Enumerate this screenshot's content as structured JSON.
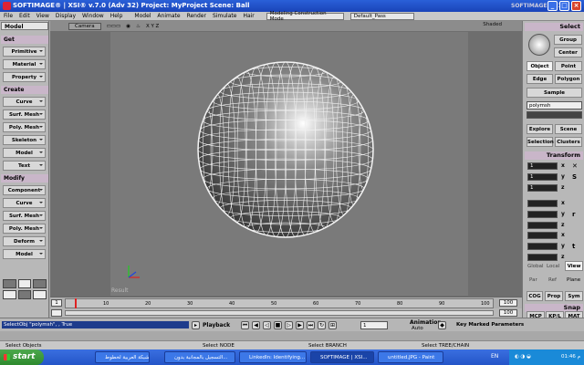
{
  "window": {
    "title": "SOFTIMAGE® | XSI® v.7.0 (Adv 32) Project: MyProject   Scene: Ball",
    "logo_text": "SOFTIMAGE® | XSI"
  },
  "menu": {
    "items": [
      "File",
      "Edit",
      "View",
      "Display",
      "Window",
      "Help",
      "Model",
      "Animate",
      "Render",
      "Simulate",
      "Hair"
    ],
    "mode": "Modeling Construction Mode",
    "pass": "Default_Pass"
  },
  "left": {
    "header": "Model",
    "sections": [
      {
        "title": "Get",
        "buttons": [
          "Primitive",
          "Material",
          "Property"
        ]
      },
      {
        "title": "Create",
        "buttons": [
          "Curve",
          "Surf. Mesh",
          "Poly. Mesh",
          "Skeleton",
          "Model",
          "Text"
        ]
      },
      {
        "title": "Modify",
        "buttons": [
          "Component",
          "Curve",
          "Surf. Mesh",
          "Poly. Mesh",
          "Deform",
          "Model"
        ]
      }
    ]
  },
  "viewport": {
    "camera": "Camera",
    "xyz": "X Y Z",
    "shading": "Shaded",
    "label": "Result"
  },
  "timeline": {
    "start": "1",
    "end": "100",
    "end2": "100",
    "ticks": [
      "10",
      "20",
      "30",
      "40",
      "50",
      "60",
      "70",
      "80",
      "90",
      "100"
    ]
  },
  "right": {
    "select_header": "Select",
    "group": "Group",
    "center": "Center",
    "object": "Object",
    "point": "Point",
    "edge": "Edge",
    "polygon": "Polygon",
    "sample": "Sample",
    "selection_field": "polymsh",
    "explore": "Explore",
    "scene": "Scene",
    "selection": "Selection",
    "clusters": "Clusters",
    "transform_header": "Transform",
    "axes": [
      "x",
      "y",
      "z"
    ],
    "scale_vals": [
      "1",
      "1",
      "1"
    ],
    "global": "Global",
    "local": "Local",
    "view": "View",
    "par": "Par",
    "ref": "Ref",
    "plane": "Plane",
    "cog": "COG",
    "prop": "Prop",
    "sym": "Sym",
    "snap_header": "Snap",
    "mcp": "MCP",
    "kpl": "KP/L",
    "mat": "MAT"
  },
  "command": {
    "line": "SelectObj \"polymsh\", , True",
    "playback": "Playback",
    "frame": "1",
    "animation": "Animation",
    "auto": "Auto",
    "key_marked": "Key Marked Parameters"
  },
  "status": {
    "left": "Select Objects",
    "mid1": "Select NODE",
    "mid2": "Select BRANCH",
    "mid3": "Select TREE/CHAIN"
  },
  "taskbar": {
    "start": "start",
    "tasks": [
      "الشبكة العربية لخطوط...",
      "التسجيل بالمجانبة بدون...",
      "LinkedIn: Identifying...",
      "SOFTIMAGE | XSI...",
      "untitled.JPG - Paint"
    ],
    "lang": "EN",
    "clock": "01:46 م"
  }
}
